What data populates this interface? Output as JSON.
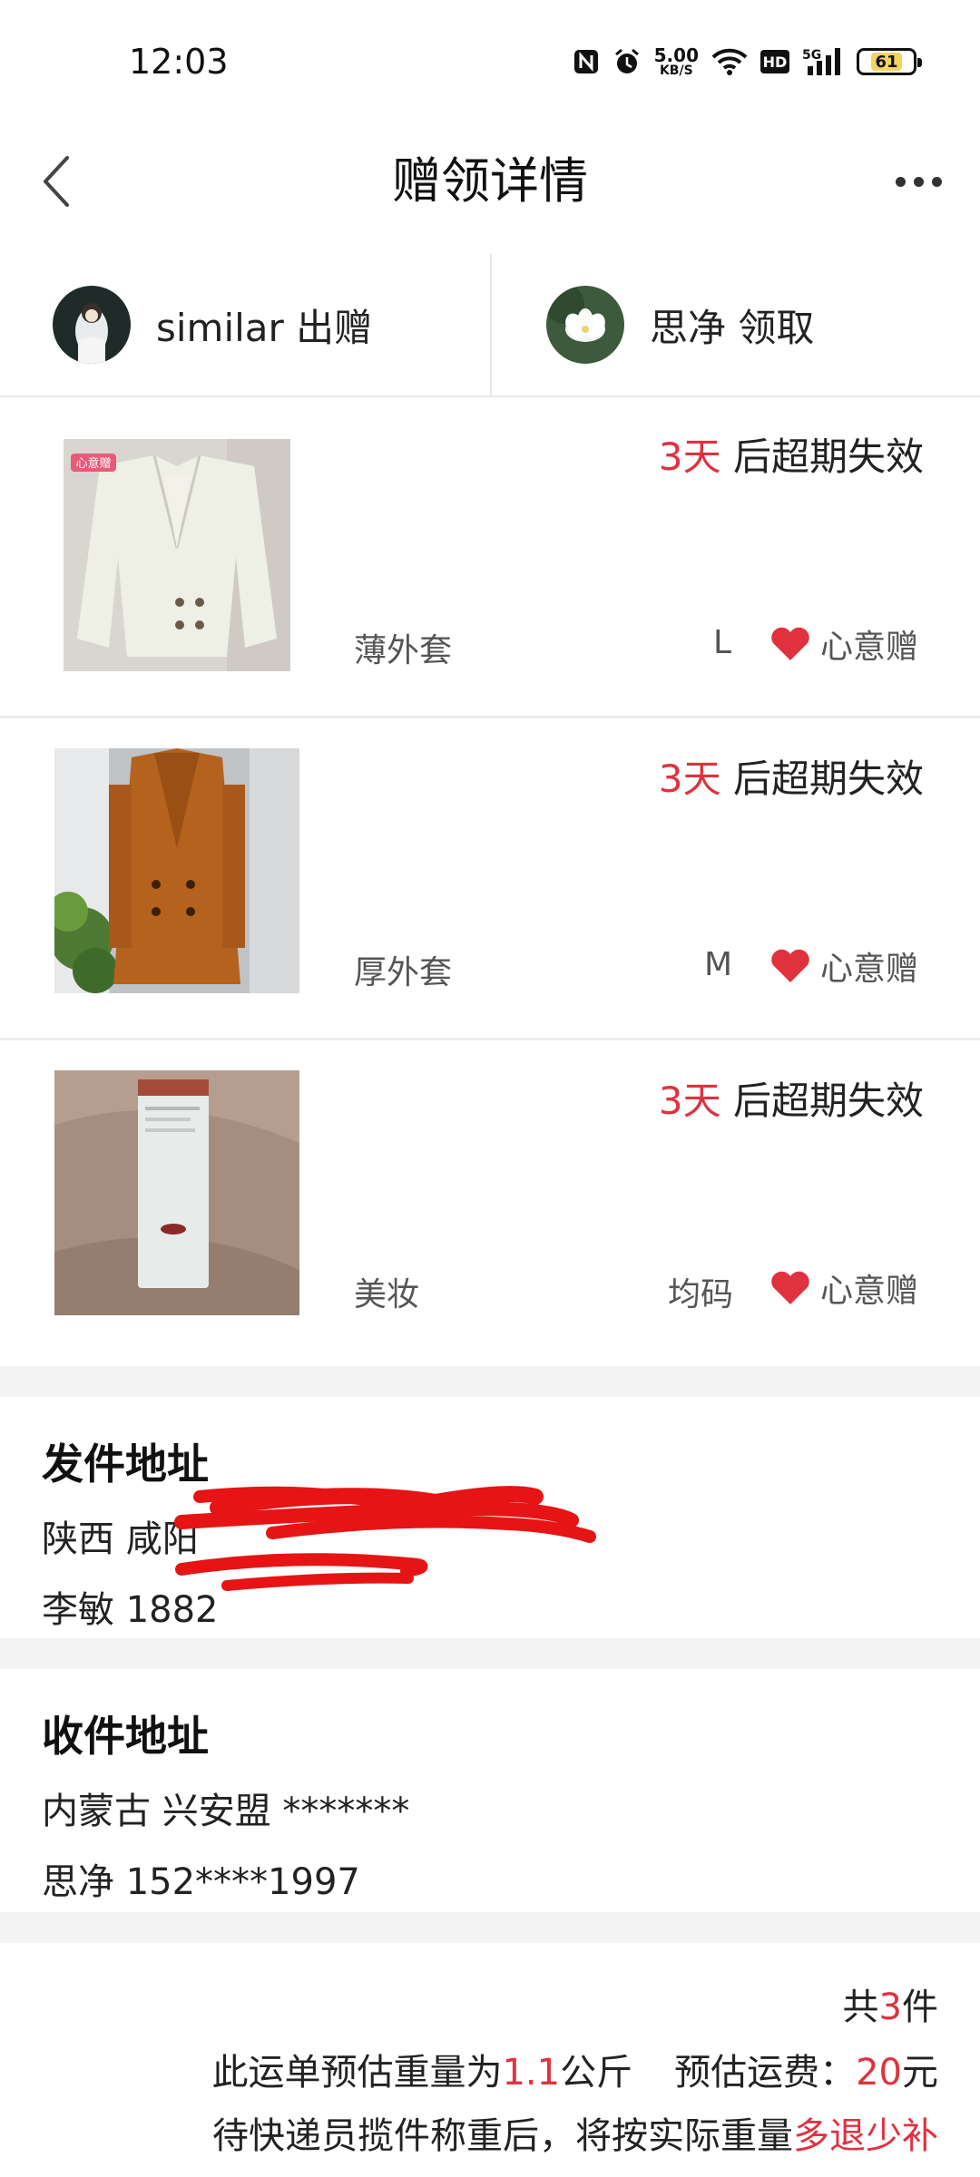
{
  "status_bar": {
    "time": "12:03",
    "net_speed": "5.00",
    "net_unit": "KB/S",
    "hd": "HD",
    "signal_label": "5G",
    "battery": "61",
    "battery_level": 0.61
  },
  "nav": {
    "title": "赠领详情"
  },
  "parties": {
    "giver": "similar 出赠",
    "receiver": "思净 领取"
  },
  "items": [
    {
      "expire_days": "3天",
      "expire_text": " 后超期失效",
      "category": "薄外套",
      "size": "L",
      "gift_tag": "心意赠",
      "thumb_badge": "心意赠"
    },
    {
      "expire_days": "3天",
      "expire_text": " 后超期失效",
      "category": "厚外套",
      "size": "M",
      "gift_tag": "心意赠"
    },
    {
      "expire_days": "3天",
      "expire_text": " 后超期失效",
      "category": "美妆",
      "size": "均码",
      "gift_tag": "心意赠"
    }
  ],
  "send_address": {
    "title": "发件地址",
    "line1": "陕西 咸阳",
    "line2": "李敏 1882"
  },
  "receive_address": {
    "title": "收件地址",
    "line1": "内蒙古 兴安盟 *******",
    "line2": "思净 152****1997"
  },
  "summary": {
    "count_prefix": "共",
    "count": "3",
    "count_suffix": "件",
    "weight_prefix": "此运单预估重量为",
    "weight": "1.1",
    "weight_unit": "公斤",
    "fee_label": "预估运费：",
    "fee": "20",
    "fee_unit": "元",
    "note_prefix": "待快递员揽件称重后，将按实际重量",
    "note_red": "多退少补"
  },
  "colors": {
    "accent_red": "#e0313f",
    "divider": "#ececec",
    "section_gap": "#f3f3f3"
  }
}
